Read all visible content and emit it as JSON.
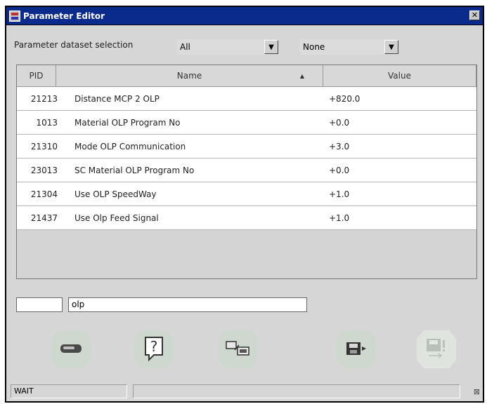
{
  "window": {
    "title": "Parameter Editor",
    "close_glyph": "✕"
  },
  "selection": {
    "label": "Parameter dataset selection",
    "dataset": "All",
    "secondary": "None",
    "arrow_glyph": "▼"
  },
  "table": {
    "headers": {
      "pid": "PID",
      "name": "Name",
      "value": "Value",
      "sort_glyph": "▲"
    },
    "rows": [
      {
        "pid": "21213",
        "name": "Distance MCP 2 OLP",
        "value": "+820.0"
      },
      {
        "pid": "1013",
        "name": "Material OLP Program No",
        "value": "+0.0"
      },
      {
        "pid": "21310",
        "name": "Mode OLP Communication",
        "value": "+3.0"
      },
      {
        "pid": "23013",
        "name": "SC Material OLP Program No",
        "value": "+0.0"
      },
      {
        "pid": "21304",
        "name": "Use OLP SpeedWay",
        "value": "+1.0"
      },
      {
        "pid": "21437",
        "name": "Use Olp Feed Signal",
        "value": "+1.0"
      }
    ]
  },
  "filter": {
    "pid_value": "",
    "search_value": "olp"
  },
  "toolbar": {
    "icons": [
      "eraser-icon",
      "help-icon",
      "transfer-icon",
      "save-icon",
      "save-disabled-icon"
    ],
    "help_glyph": "?"
  },
  "status": {
    "text": "WAIT",
    "grip_glyph": "⊠"
  },
  "colors": {
    "title_bar": "#0a2a8c",
    "window_bg": "#d6d6d6",
    "button_bg": "#cfd8cf"
  }
}
